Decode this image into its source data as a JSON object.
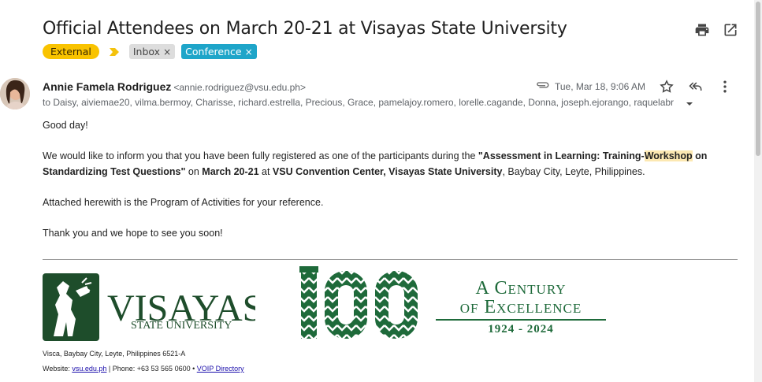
{
  "email": {
    "subject": "Official Attendees on March 20-21 at Visayas State University",
    "labels": {
      "external": "External",
      "inbox": "Inbox",
      "conference": "Conference",
      "remove_glyph": "×"
    },
    "sender": {
      "name": "Annie Famela Rodriguez",
      "email": "<annie.rodriguez@vsu.edu.ph>",
      "avatar_icon": "profile-photo"
    },
    "date": "Tue, Mar 18, 9:06 AM",
    "to": "to Daisy, aiviemae20, vilma.bermoy, Charisse, richard.estrella, Precious, Grace, pamelajoy.romero, lorelle.cagande, Donna, joseph.ejorango, raquelabr",
    "body": {
      "greeting": "Good day!",
      "p1_a": "We would like to inform you that you have been fully registered as one of the participants during the ",
      "p1_b": "\"Assessment in Learning: Training-",
      "p1_hl": "Workshop",
      "p1_c": " on Standardizing Test Questions\"",
      "p1_d": " on ",
      "p1_e": "March 20-21",
      "p1_f": " at ",
      "p1_g": "VSU Convention Center, Visayas State University",
      "p1_h": ", Baybay City, Leyte, Philippines.",
      "p2": "Attached herewith is the Program of Activities for your reference.",
      "p3": "Thank you and we hope to see you soon!"
    }
  },
  "signature": {
    "logo_word": "VISAYAS",
    "logo_sub": "STATE UNIVERSITY",
    "century_number": "100",
    "century_line1": "A Century",
    "century_line2": "of Excellence",
    "century_years": "1924 - 2024",
    "address": "Visca, Baybay City, Leyte, Philippines 6521-A",
    "website_label": "Website: ",
    "website_link": "vsu.edu.ph",
    "phone": " | Phone: +63 53 565 0600 • ",
    "voip_link": "VOIP Directory"
  },
  "colors": {
    "external": "#f9c300",
    "conference": "#1ea5c9",
    "vsu_green": "#1e6a3a",
    "highlight": "#fce8b2"
  },
  "icons": [
    "print-icon",
    "open-new-window-icon",
    "label-arrow-icon",
    "attachment-icon",
    "star-icon",
    "reply-all-icon",
    "more-vert-icon",
    "expand-caret-icon"
  ]
}
